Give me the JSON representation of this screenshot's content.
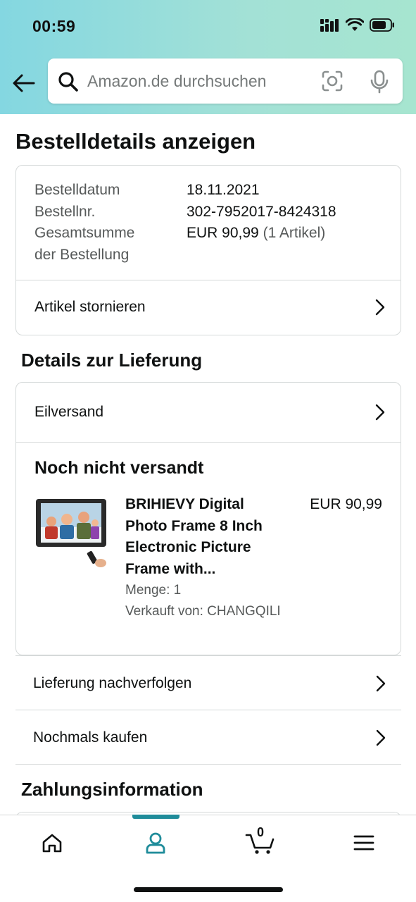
{
  "status_bar": {
    "time": "00:59"
  },
  "search": {
    "placeholder": "Amazon.de durchsuchen"
  },
  "page": {
    "title": "Bestelldetails anzeigen"
  },
  "order_summary": {
    "date_label": "Bestelldatum",
    "date_value": "18.11.2021",
    "number_label": "Bestellnr.",
    "number_value": "302-7952017-8424318",
    "total_label_line1": "Gesamtsumme",
    "total_label_line2": "der Bestellung",
    "total_value": "EUR 90,99",
    "total_items": "(1 Artikel)",
    "cancel_label": "Artikel stornieren"
  },
  "delivery": {
    "heading": "Details zur Lieferung",
    "shipping_speed": "Eilversand",
    "status": "Noch nicht versandt",
    "item": {
      "title": "BRIHIEVY Digital Photo Frame 8 Inch Electronic Picture Frame with...",
      "price": "EUR 90,99",
      "quantity": "Menge: 1",
      "seller": "Verkauft von: CHANGQILI"
    }
  },
  "actions": {
    "track": "Lieferung nachverfolgen",
    "buy_again": "Nochmals kaufen"
  },
  "payment": {
    "heading": "Zahlungsinformation"
  },
  "tabbar": {
    "items": [
      "home-icon",
      "account-icon",
      "cart-icon",
      "menu-icon"
    ],
    "active": "account-icon",
    "cart_count": "0",
    "accent_color": "#1f8c9a"
  }
}
